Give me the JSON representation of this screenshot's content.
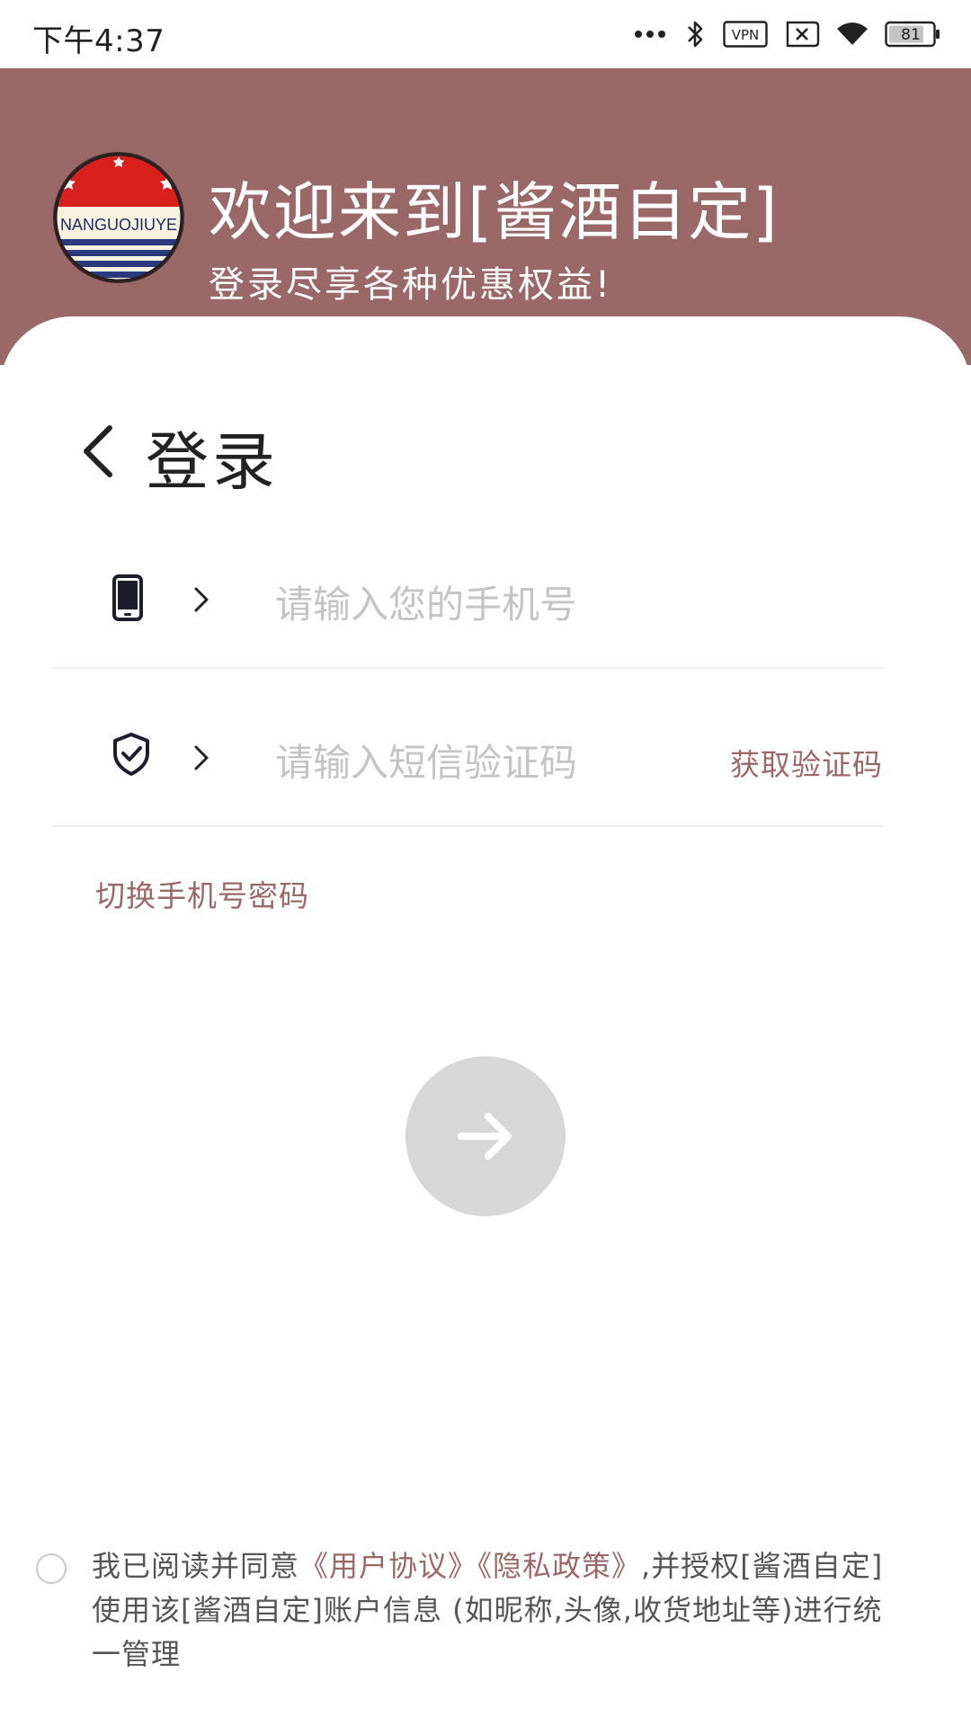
{
  "status_bar": {
    "time": "下午4:37",
    "vpn_label": "VPN",
    "battery": "81"
  },
  "header": {
    "logo_text": "NANGUOJIUYE",
    "title": "欢迎来到[酱酒自定]",
    "subtitle": "登录尽享各种优惠权益!"
  },
  "login": {
    "title": "登录",
    "phone_placeholder": "请输入您的手机号",
    "code_placeholder": "请输入短信验证码",
    "get_code_label": "获取验证码",
    "switch_label": "切换手机号密码"
  },
  "agreement": {
    "prefix": "我已阅读并同意",
    "user_agreement": "《用户协议》",
    "privacy_policy": "《隐私政策》",
    "suffix": ",并授权[酱酒自定]使用该[酱酒自定]账户信息 (如昵称,头像,收货地址等)进行统一管理"
  },
  "colors": {
    "brand": "#9b6868",
    "button_disabled": "#d7d7d7",
    "placeholder": "#c4c4c4"
  },
  "icons": [
    "more-icon",
    "bluetooth-icon",
    "vpn-icon",
    "no-sim-icon",
    "wifi-icon",
    "battery-icon",
    "back-arrow-icon",
    "phone-icon",
    "shield-check-icon",
    "chevron-right-icon",
    "arrow-right-icon"
  ]
}
